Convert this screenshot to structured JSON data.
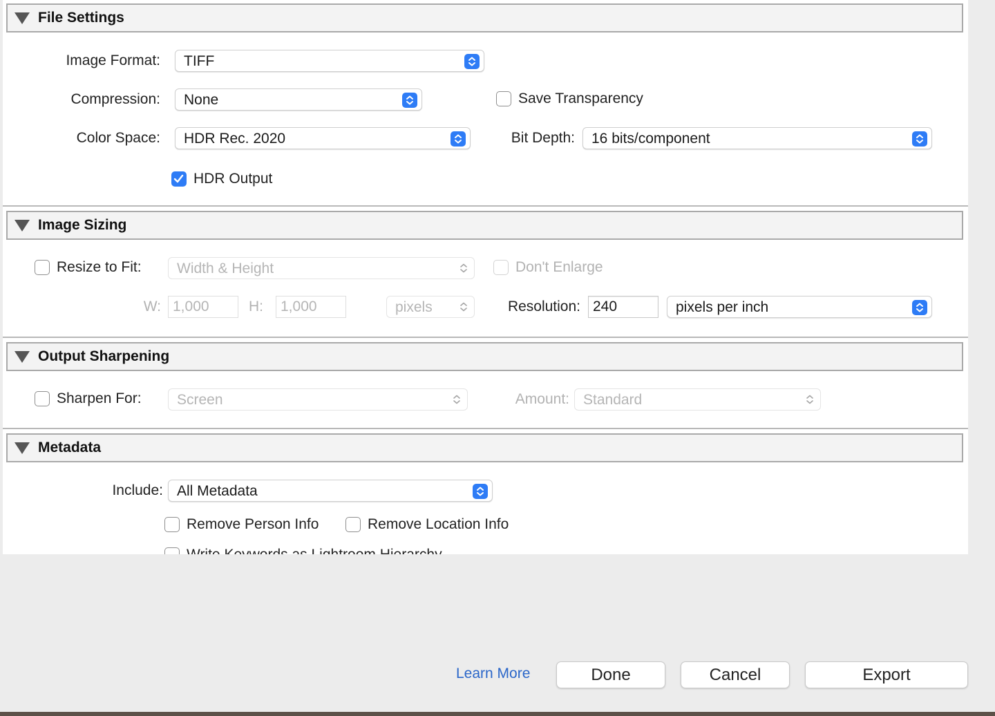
{
  "file_settings": {
    "title": "File Settings",
    "image_format": {
      "label": "Image Format:",
      "value": "TIFF"
    },
    "compression": {
      "label": "Compression:",
      "value": "None"
    },
    "save_transparency": {
      "label": "Save Transparency",
      "checked": false
    },
    "color_space": {
      "label": "Color Space:",
      "value": "HDR Rec. 2020"
    },
    "bit_depth": {
      "label": "Bit Depth:",
      "value": "16 bits/component"
    },
    "hdr_output": {
      "label": "HDR Output",
      "checked": true
    }
  },
  "image_sizing": {
    "title": "Image Sizing",
    "resize_to_fit": {
      "label": "Resize to Fit:",
      "checked": false,
      "value": "Width & Height"
    },
    "dont_enlarge": {
      "label": "Don't Enlarge",
      "checked": false
    },
    "width": {
      "label": "W:",
      "value": "1,000"
    },
    "height": {
      "label": "H:",
      "value": "1,000"
    },
    "units": {
      "value": "pixels"
    },
    "resolution": {
      "label": "Resolution:",
      "value": "240",
      "units": "pixels per inch"
    }
  },
  "output_sharpening": {
    "title": "Output Sharpening",
    "sharpen_for": {
      "label": "Sharpen For:",
      "checked": false,
      "value": "Screen"
    },
    "amount": {
      "label": "Amount:",
      "value": "Standard"
    }
  },
  "metadata": {
    "title": "Metadata",
    "include": {
      "label": "Include:",
      "value": "All Metadata"
    },
    "remove_person_info": {
      "label": "Remove Person Info",
      "checked": false
    },
    "remove_location_info": {
      "label": "Remove Location Info",
      "checked": false
    },
    "write_keywords": {
      "label": "Write Keywords as Lightroom Hierarchy",
      "checked": false
    }
  },
  "footer": {
    "learn_more": "Learn More",
    "done": "Done",
    "cancel": "Cancel",
    "export": "Export"
  },
  "colors": {
    "accent": "#2e7cf6",
    "link": "#2a66c9"
  }
}
